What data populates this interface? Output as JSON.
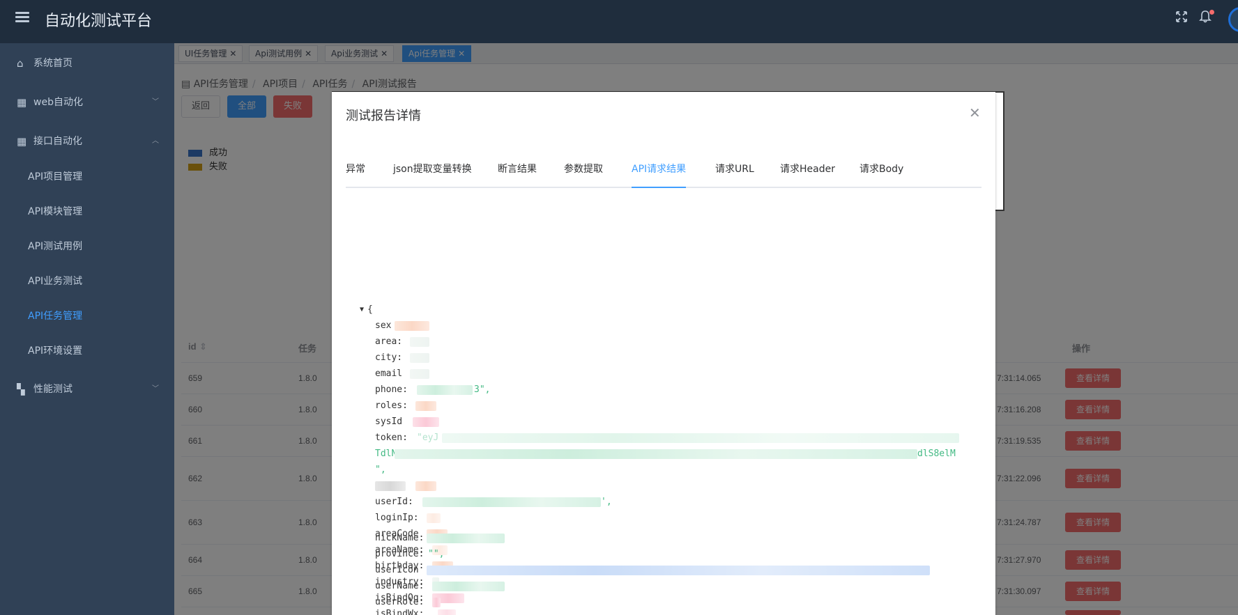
{
  "header": {
    "app_title": "自动化测试平台",
    "fullscreen_icon": "fullscreen-icon",
    "bell_icon": "bell-icon"
  },
  "sidebar": {
    "items": [
      {
        "label": "系统首页",
        "icon": "home-icon"
      },
      {
        "label": "web自动化",
        "icon": "grid-icon"
      },
      {
        "label": "接口自动化",
        "icon": "grid-icon"
      }
    ],
    "subitems": [
      {
        "label": "API项目管理"
      },
      {
        "label": "API模块管理"
      },
      {
        "label": "API测试用例"
      },
      {
        "label": "API业务测试"
      },
      {
        "label": "API任务管理"
      },
      {
        "label": "API环境设置"
      }
    ],
    "perf": {
      "label": "性能测试",
      "icon": "dashboard-icon"
    },
    "active_color": "#409eff"
  },
  "tags": [
    {
      "label": "UI任务管理"
    },
    {
      "label": "Api测试用例"
    },
    {
      "label": "Api业务测试"
    },
    {
      "label": "Api任务管理"
    }
  ],
  "breadcrumb": {
    "items": [
      "API任务管理",
      "API项目",
      "API任务",
      "API测试报告"
    ]
  },
  "buttons": {
    "back": "返回",
    "all": "全部",
    "fail": "失败"
  },
  "legend": {
    "success": "成功",
    "fail": "失败",
    "success_color": "#3874c8",
    "fail_color": "#d4a017"
  },
  "table": {
    "headers": {
      "id": "id",
      "task": "任务",
      "ops": "操作"
    },
    "rows": [
      {
        "id": "659",
        "task": "1.8.0",
        "time": "7:31:14.065",
        "action": "查看详情"
      },
      {
        "id": "660",
        "task": "1.8.0",
        "time": "7:31:16.208",
        "action": "查看详情"
      },
      {
        "id": "661",
        "task": "1.8.0",
        "time": "7:31:19.535",
        "action": "查看详情"
      },
      {
        "id": "662",
        "task": "1.8.0",
        "time": "7:31:22.096",
        "action": "查看详情"
      },
      {
        "id": "663",
        "task": "1.8.0",
        "time": "7:31:24.787",
        "action": "查看详情"
      },
      {
        "id": "664",
        "task": "1.8.0",
        "time": "7:31:27.970",
        "action": "查看详情"
      },
      {
        "id": "665",
        "task": "1.8.0",
        "time": "7:31:30.097",
        "action": "查看详情"
      }
    ]
  },
  "modal": {
    "title": "测试报告详情",
    "tabs": [
      "异常",
      "json提取变量转换",
      "断言结果",
      "参数提取",
      "API请求结果",
      "请求URL",
      "请求Header",
      "请求Body"
    ],
    "active_tab": "API请求结果",
    "json": {
      "open_brace": "{",
      "keys": [
        "sex",
        "area:",
        "city:",
        "email",
        "phone:",
        "roles:",
        "sysId",
        "token:",
        "userId:",
        "loginIp:",
        "areaCode",
        "areaName:",
        "birthday:",
        "industry:",
        "isBindQq:",
        "isBindWx:",
        "nickName:",
        "province:",
        "userIcon",
        "userName:",
        "userRole:"
      ],
      "phone_tail": "3\",",
      "token_start": "\"eyJ",
      "token_line2": "TdlN",
      "token_line2_tail": "dlS8elM",
      "token_end": "\",",
      "userid_tail": "',",
      "province_val": "\"\","
    }
  }
}
